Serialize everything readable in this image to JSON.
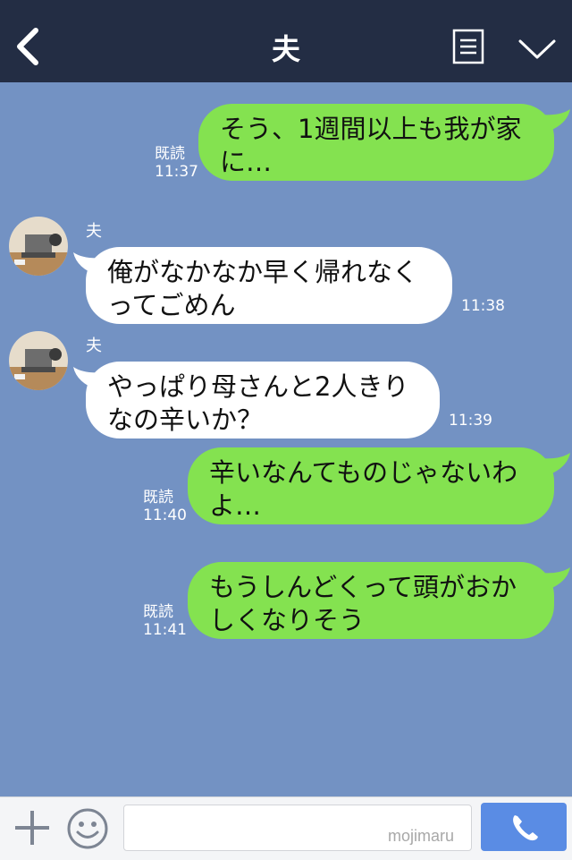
{
  "header": {
    "title": "夫"
  },
  "messages": [
    {
      "text": "そう、1週間以上も我が家\nに…",
      "read": "既読",
      "time": "11:37"
    },
    {
      "sender": "夫",
      "text": "俺がなかなか早く帰れなく\nってごめん",
      "time": "11:38"
    },
    {
      "sender": "夫",
      "text": "やっぱり母さんと2人きり\nなの辛いか？",
      "time": "11:39"
    },
    {
      "text": "辛いなんてものじゃないわ\nよ…",
      "read": "既読",
      "time": "11:40"
    },
    {
      "text": "もうしんどくって頭がおか\nしくなりそう",
      "read": "既読",
      "time": "11:41"
    }
  ],
  "input": {
    "placeholder": ""
  },
  "watermark": "mojimaru",
  "colors": {
    "header": "#232d44",
    "background": "#7392c3",
    "outgoing": "#84e250",
    "incoming": "#ffffff",
    "call": "#5a8ce4"
  }
}
